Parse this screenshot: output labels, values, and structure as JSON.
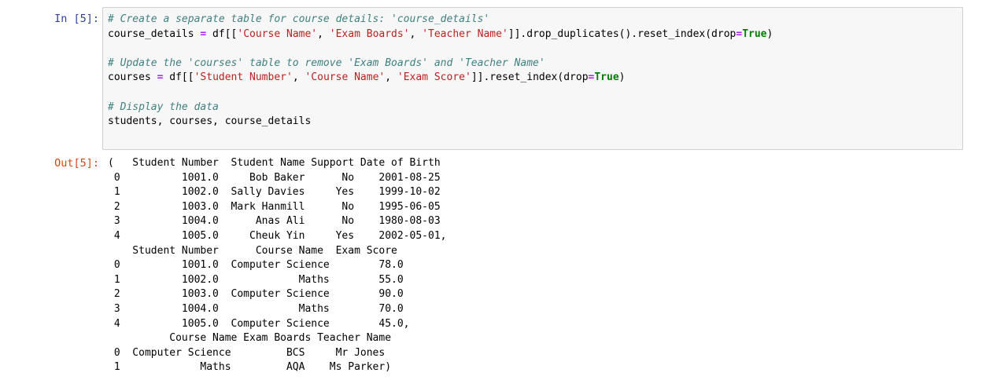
{
  "cell": {
    "in_prompt": "In [5]:",
    "out_prompt": "Out[5]:",
    "code": {
      "comment1": "# Create a separate table for course details: 'course_details'",
      "l2_var": "course_details ",
      "l2_eq": "=",
      "l2_a": " df[[",
      "l2_s1": "'Course Name'",
      "l2_c1": ", ",
      "l2_s2": "'Exam Boards'",
      "l2_c2": ", ",
      "l2_s3": "'Teacher Name'",
      "l2_b": "]].drop_duplicates().reset_index(drop",
      "l2_eq2": "=",
      "l2_true": "True",
      "l2_end": ")",
      "comment2": "# Update the 'courses' table to remove 'Exam Boards' and 'Teacher Name'",
      "l5_var": "courses ",
      "l5_eq": "=",
      "l5_a": " df[[",
      "l5_s1": "'Student Number'",
      "l5_c1": ", ",
      "l5_s2": "'Course Name'",
      "l5_c2": ", ",
      "l5_s3": "'Exam Score'",
      "l5_b": "]].reset_index(drop",
      "l5_eq2": "=",
      "l5_true": "True",
      "l5_end": ")",
      "comment3": "# Display the data",
      "l8": "students, courses, course_details"
    },
    "output_lines": [
      "(   Student Number  Student Name Support Date of Birth",
      " 0          1001.0     Bob Baker      No    2001-08-25",
      " 1          1002.0  Sally Davies     Yes    1999-10-02",
      " 2          1003.0  Mark Hanmill      No    1995-06-05",
      " 3          1004.0      Anas Ali      No    1980-08-03",
      " 4          1005.0     Cheuk Yin     Yes    2002-05-01,",
      "    Student Number      Course Name  Exam Score",
      " 0          1001.0  Computer Science        78.0",
      " 1          1002.0             Maths        55.0",
      " 2          1003.0  Computer Science        90.0",
      " 3          1004.0             Maths        70.0",
      " 4          1005.0  Computer Science        45.0,",
      "          Course Name Exam Boards Teacher Name",
      " 0  Computer Science         BCS     Mr Jones",
      " 1             Maths         AQA    Ms Parker)"
    ]
  }
}
